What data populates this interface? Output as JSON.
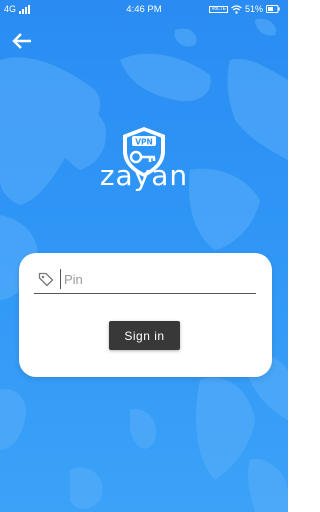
{
  "status_bar": {
    "network": "4G",
    "time": "4:46 PM",
    "volte": "VoLTE",
    "battery": "51%"
  },
  "nav": {
    "back_icon": "arrow-left-icon"
  },
  "brand": {
    "badge_text": "VPN",
    "name": "zayan"
  },
  "login": {
    "pin_placeholder": "Pin",
    "pin_icon": "tag-icon",
    "sign_in_label": "Sign in"
  },
  "colors": {
    "background": "#2e95f6",
    "card": "#ffffff",
    "button": "#383838"
  }
}
